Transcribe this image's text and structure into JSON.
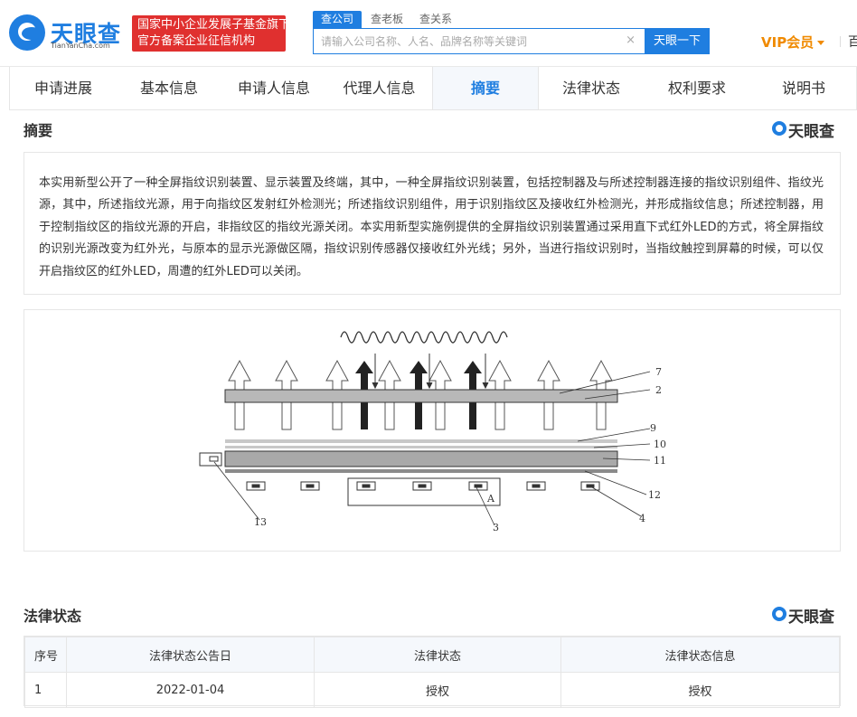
{
  "header": {
    "logo_title": "天眼查",
    "logo_sub": "TianYanCha.com",
    "badge_line1": "国家中小企业发展子基金旗下",
    "badge_line2": "官方备案企业征信机构",
    "search_tabs": [
      "查公司",
      "查老板",
      "查关系"
    ],
    "search_placeholder": "请输入公司名称、人名、品牌名称等关键词",
    "search_clear": "×",
    "search_button": "天眼一下",
    "vip_label": "VIP会员",
    "more_label": "百"
  },
  "tabs": [
    "申请进展",
    "基本信息",
    "申请人信息",
    "代理人信息",
    "摘要",
    "法律状态",
    "权利要求",
    "说明书"
  ],
  "active_tab": "摘要",
  "abstract": {
    "title": "摘要",
    "watermark": "天眼查",
    "text": "本实用新型公开了一种全屏指纹识别装置、显示装置及终端，其中，一种全屏指纹识别装置，包括控制器及与所述控制器连接的指纹识别组件、指纹光源，其中，所述指纹光源，用于向指纹区发射红外检测光；所述指纹识别组件，用于识别指纹区及接收红外检测光，并形成指纹信息；所述控制器，用于控制指纹区的指纹光源的开启，非指纹区的指纹光源关闭。本实用新型实施例提供的全屏指纹识别装置通过采用直下式红外LED的方式，将全屏指纹的识别光源改变为红外光，与原本的显示光源做区隔，指纹识别传感器仅接收红外光线；另外，当进行指纹识别时，当指纹触控到屏幕的时候，可以仅开启指纹区的红外LED，周遭的红外LED可以关闭。"
  },
  "figure": {
    "labels": {
      "l7": "7",
      "l2": "2",
      "l9": "9",
      "l10": "10",
      "l11": "11",
      "l12": "12",
      "l13": "13",
      "l4": "4",
      "l3": "3",
      "lA": "A"
    }
  },
  "legal": {
    "title": "法律状态",
    "watermark": "天眼查",
    "columns": [
      "序号",
      "法律状态公告日",
      "法律状态",
      "法律状态信息"
    ],
    "rows": [
      [
        "1",
        "2022-01-04",
        "授权",
        "授权"
      ]
    ]
  },
  "colors": {
    "brand_blue": "#1f7ee0",
    "badge_red": "#e0302f",
    "vip_orange": "#f08a00"
  }
}
